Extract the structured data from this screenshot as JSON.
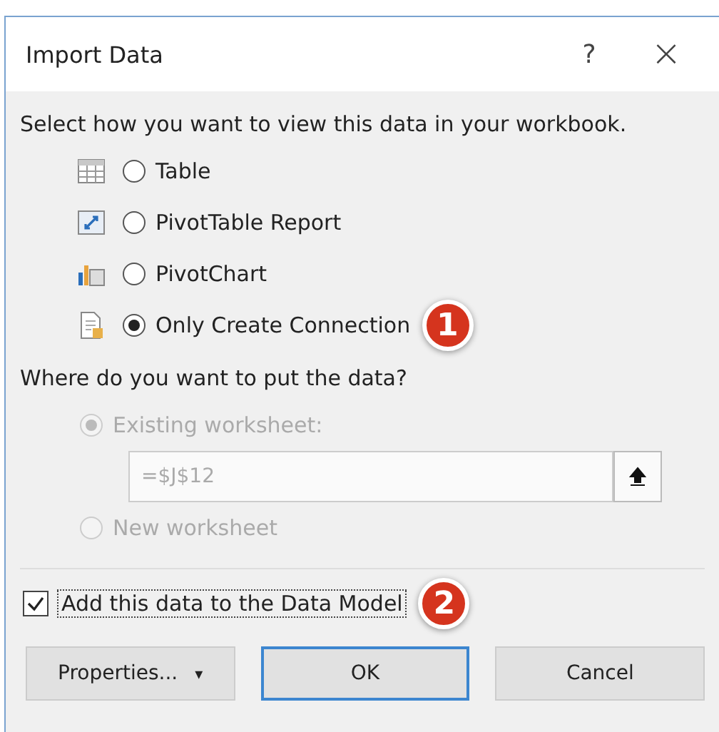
{
  "window": {
    "title": "Import Data",
    "help": "?",
    "close": "×"
  },
  "view_prompt": "Select how you want to view this data in your workbook.",
  "view_options": [
    {
      "kind": "table",
      "label": "Table",
      "selected": false
    },
    {
      "kind": "pivottable",
      "label": "PivotTable Report",
      "selected": false
    },
    {
      "kind": "pivotchart",
      "label": "PivotChart",
      "selected": false
    },
    {
      "kind": "connection",
      "label": "Only Create Connection",
      "selected": true,
      "badge": "1"
    }
  ],
  "location_prompt": "Where do you want to put the data?",
  "location_options": [
    {
      "label": "Existing worksheet:",
      "selected": true,
      "disabled": true
    },
    {
      "label": "New worksheet",
      "selected": false,
      "disabled": true
    }
  ],
  "range_field": {
    "value": "=$J$12",
    "disabled": true
  },
  "data_model": {
    "label": "Add this data to the Data Model",
    "checked": true,
    "badge": "2"
  },
  "buttons": [
    {
      "kind": "dropdown",
      "label": "Properties...",
      "caret": "▾",
      "default": false
    },
    {
      "kind": "plain",
      "label": "OK",
      "default": true
    },
    {
      "kind": "plain",
      "label": "Cancel",
      "default": false
    }
  ]
}
